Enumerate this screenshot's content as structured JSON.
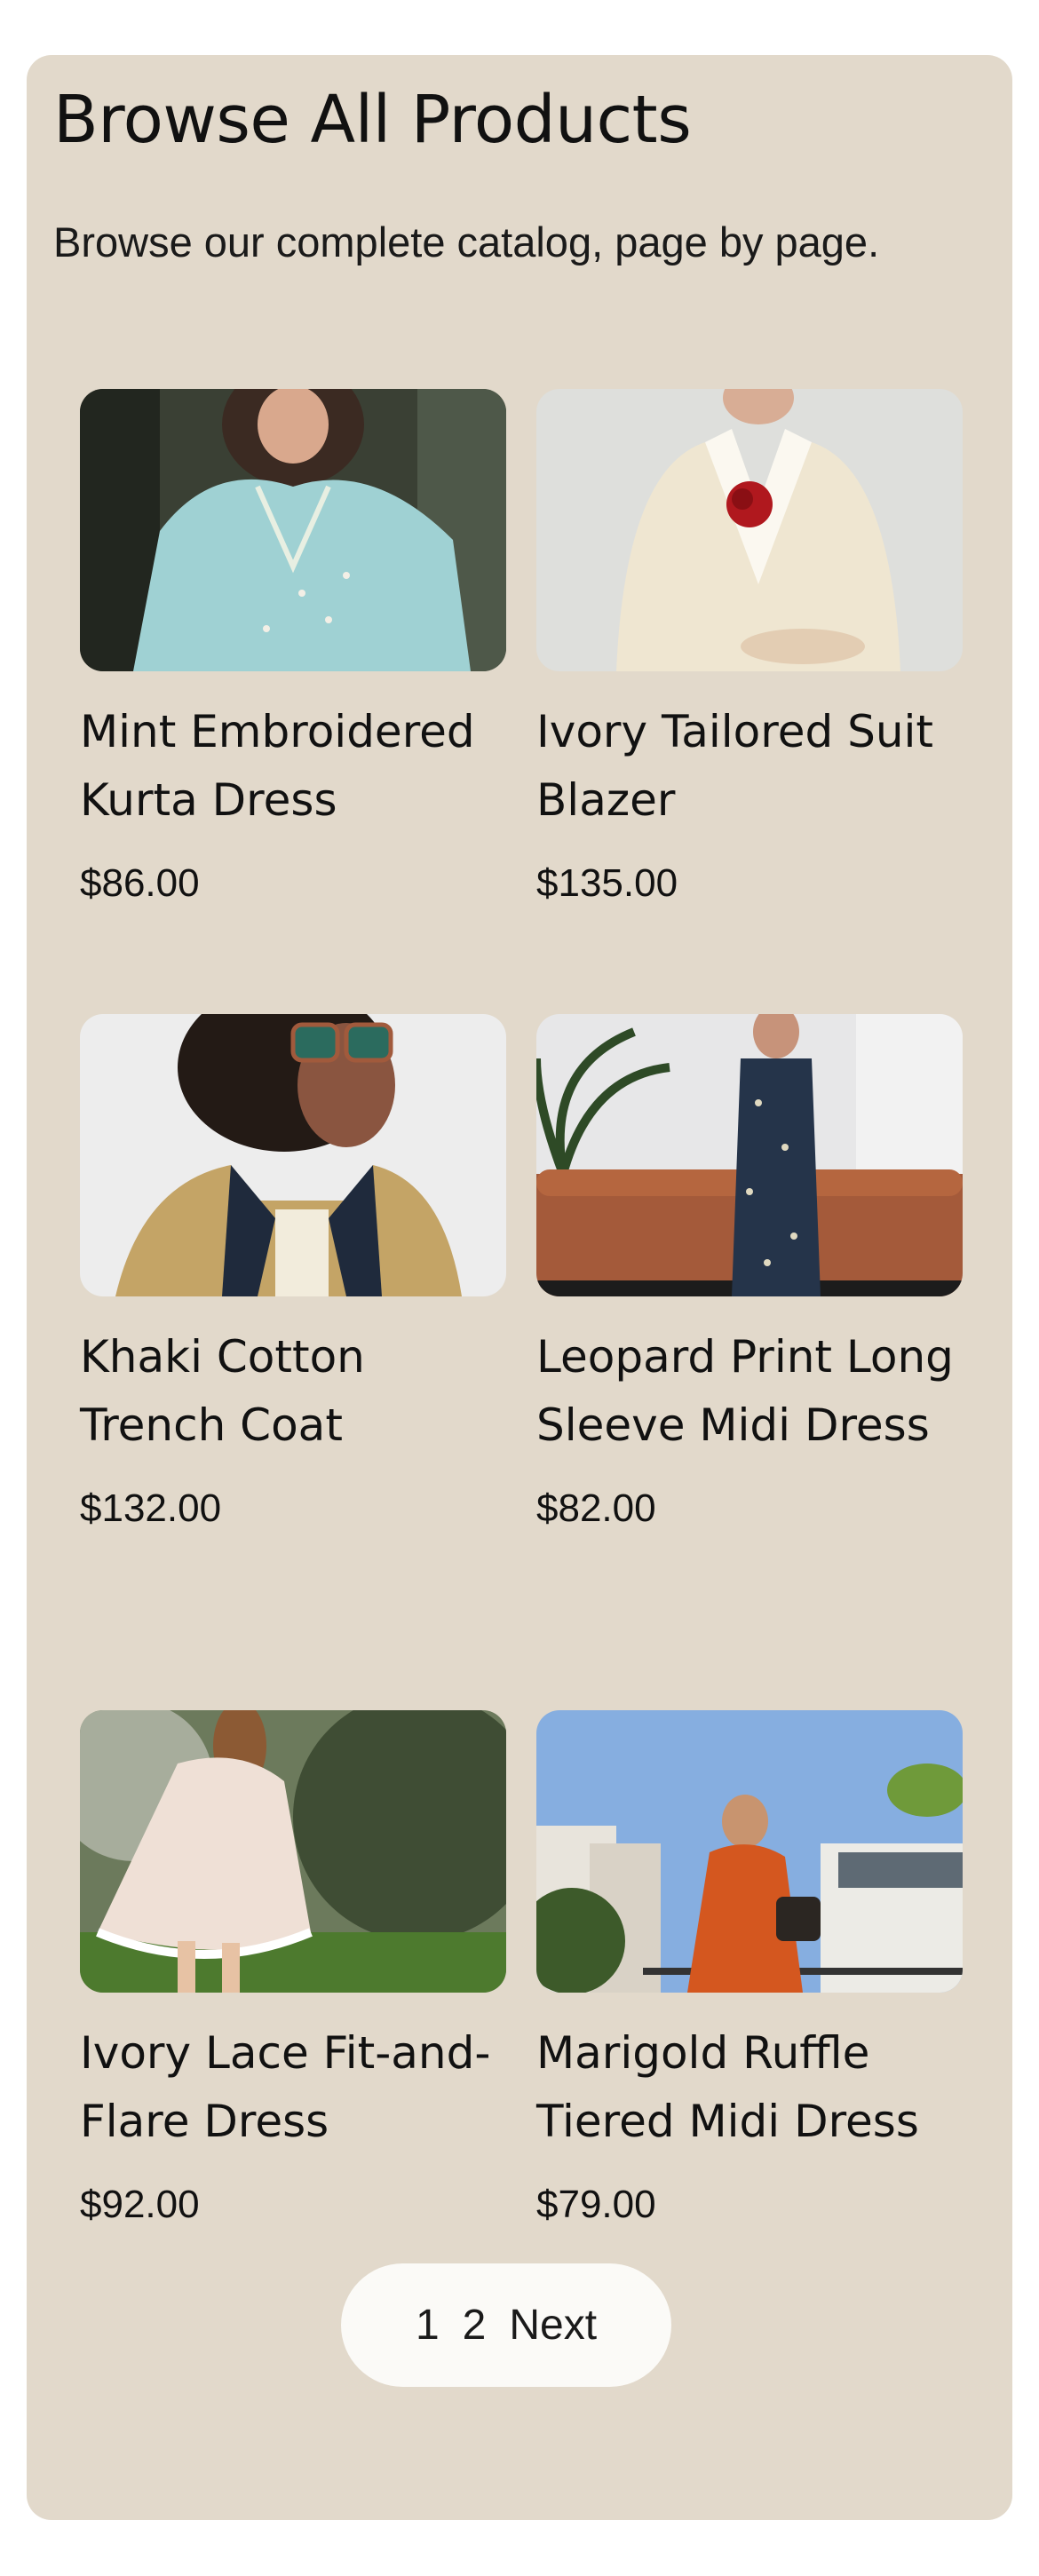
{
  "page": {
    "title": "Browse All Products",
    "subtitle": "Browse our complete catalog, page by page."
  },
  "products": [
    {
      "name": "Mint Embroidered Kurta Dress",
      "price": "$86.00"
    },
    {
      "name": "Ivory Tailored Suit Blazer",
      "price": "$135.00"
    },
    {
      "name": "Khaki Cotton Trench Coat",
      "price": "$132.00"
    },
    {
      "name": "Leopard Print Long Sleeve Midi Dress",
      "price": "$82.00"
    },
    {
      "name": "Ivory Lace Fit-and-Flare Dress",
      "price": "$92.00"
    },
    {
      "name": "Marigold Ruffle Tiered Midi Dress",
      "price": "$79.00"
    }
  ],
  "pagination": {
    "page1": "1",
    "page2": "2",
    "next": "Next"
  },
  "colors": {
    "card_background": "#e2d9cb",
    "pager_background": "#fbfaf7",
    "text": "#111111"
  }
}
